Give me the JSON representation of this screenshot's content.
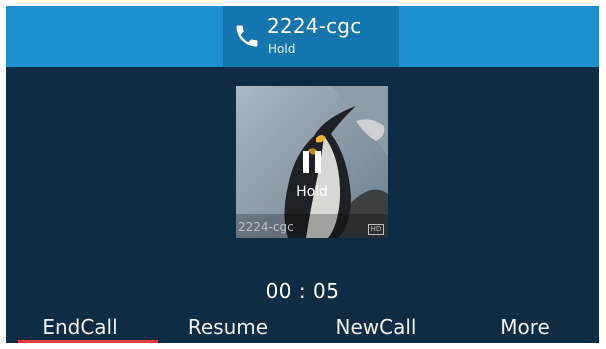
{
  "header": {
    "title": "2224-cgc",
    "subtitle": "Hold",
    "icon": "phone-icon"
  },
  "contact": {
    "hold_label": "Hold",
    "overlay_name": "2224-cgc",
    "hd_badge": "HD",
    "icon": "pause-icon"
  },
  "call": {
    "timer": "00 : 05"
  },
  "softkeys": [
    {
      "label": "EndCall"
    },
    {
      "label": "Resume"
    },
    {
      "label": "NewCall"
    },
    {
      "label": "More"
    }
  ],
  "colors": {
    "top_bar": "#1d8fd1",
    "title_block": "#1576ad",
    "background": "#0f2c45",
    "indicator": "#e23b3b"
  }
}
